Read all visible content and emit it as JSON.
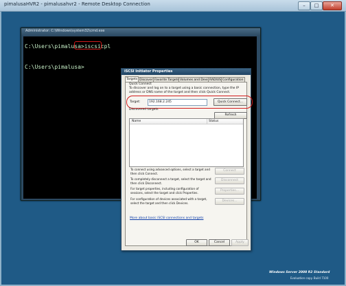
{
  "rdp_window": {
    "title": "pimalusaHVR2 - pimalusahvr2 - Remote Desktop Connection",
    "min_label": "–",
    "max_label": "□",
    "close_label": "✕"
  },
  "cmd_window": {
    "title": "Administrator: C:\\Windows\\system32\\cmd.exe",
    "lines": [
      "C:\\Users\\pimalusa>iscsicpl",
      "",
      "C:\\Users\\pimalusa>"
    ],
    "highlight_color": "#d31b1b"
  },
  "iscsi_dialog": {
    "title": "iSCSI Initiator Properties",
    "tabs": [
      {
        "label": "Targets",
        "active": true
      },
      {
        "label": "Discovery",
        "active": false
      },
      {
        "label": "Favorite Targets",
        "active": false
      },
      {
        "label": "Volumes and Devices",
        "active": false
      },
      {
        "label": "RADIUS",
        "active": false
      },
      {
        "label": "Configuration",
        "active": false
      }
    ],
    "quick_connect": {
      "group_label": "Quick Connect",
      "description": "To discover and log on to a target using a basic connection, type the IP address or DNS name of the target and then click Quick Connect.",
      "target_label": "Target:",
      "target_value": "192.168.2.245",
      "button_label": "Quick Connect..."
    },
    "discovered_targets": {
      "group_label": "Discovered targets",
      "refresh_label": "Refresh",
      "columns": [
        "Name",
        "Status"
      ],
      "rows": []
    },
    "actions": [
      {
        "text": "To connect using advanced options, select a target and then click Connect.",
        "button": "Connect"
      },
      {
        "text": "To completely disconnect a target, select the target and then click Disconnect.",
        "button": "Disconnect"
      },
      {
        "text": "For target properties, including configuration of sessions, select the target and click Properties.",
        "button": "Properties..."
      },
      {
        "text": "For configuration of devices associated with a target, select the target and then click Devices.",
        "button": "Devices..."
      }
    ],
    "more_link": "More about basic iSCSI connections and targets",
    "ok_label": "OK",
    "cancel_label": "Cancel",
    "apply_label": "Apply"
  },
  "watermark": {
    "line1": "Windows Server 2008 R2 Standard",
    "line2": "Evaluation copy. Build 7100"
  },
  "colors": {
    "desktop": "#1f5a86",
    "annotation_red": "#d31b1b",
    "link": "#0b3ba8"
  }
}
